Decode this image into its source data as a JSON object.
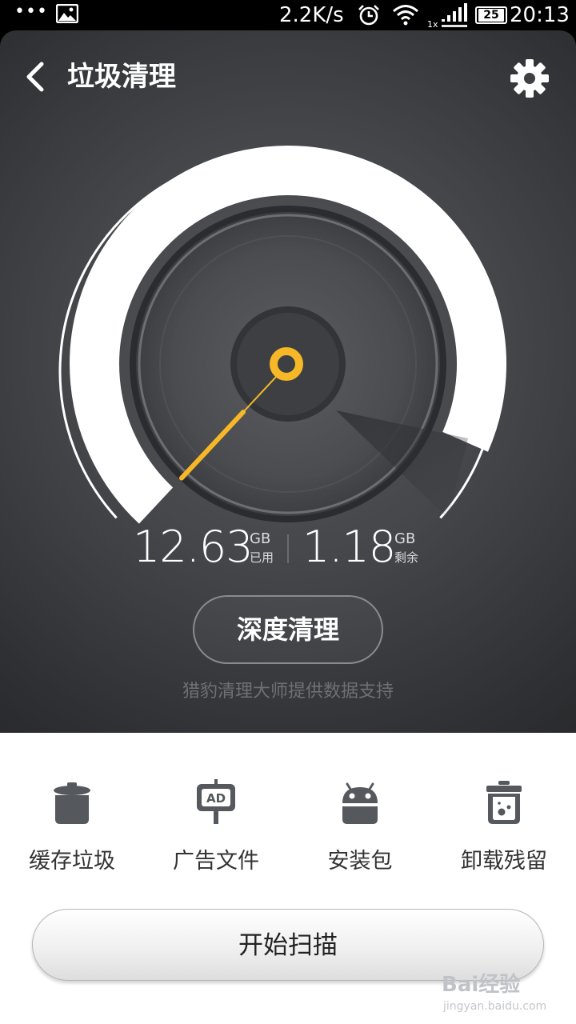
{
  "status_bar": {
    "dots": "•••",
    "speed": "2.2K/s",
    "signal_label": "1x",
    "battery": "25",
    "time": "20:13"
  },
  "header": {
    "title": "垃圾清理",
    "back_icon": "back-arrow-icon",
    "settings_icon": "gear-icon"
  },
  "storage": {
    "used_value": "12.63",
    "used_unit": "GB",
    "used_label": "已用",
    "remaining_value": "1.18",
    "remaining_unit": "GB",
    "remaining_label": "剩余",
    "used_fraction": 0.915
  },
  "deep_clean_label": "深度清理",
  "credit": "猎豹清理大师提供数据支持",
  "categories": [
    {
      "label": "缓存垃圾",
      "icon": "trash-can-icon"
    },
    {
      "label": "广告文件",
      "icon": "ad-sign-icon"
    },
    {
      "label": "安装包",
      "icon": "android-icon"
    },
    {
      "label": "卸载残留",
      "icon": "residue-bin-icon"
    }
  ],
  "scan_label": "开始扫描",
  "watermark": {
    "top": "Bai经验",
    "bottom": "jingyan.baidu.com"
  },
  "colors": {
    "accent": "#f6b826",
    "panel_dark": "#3a3b3e",
    "arc": "#ffffff"
  }
}
